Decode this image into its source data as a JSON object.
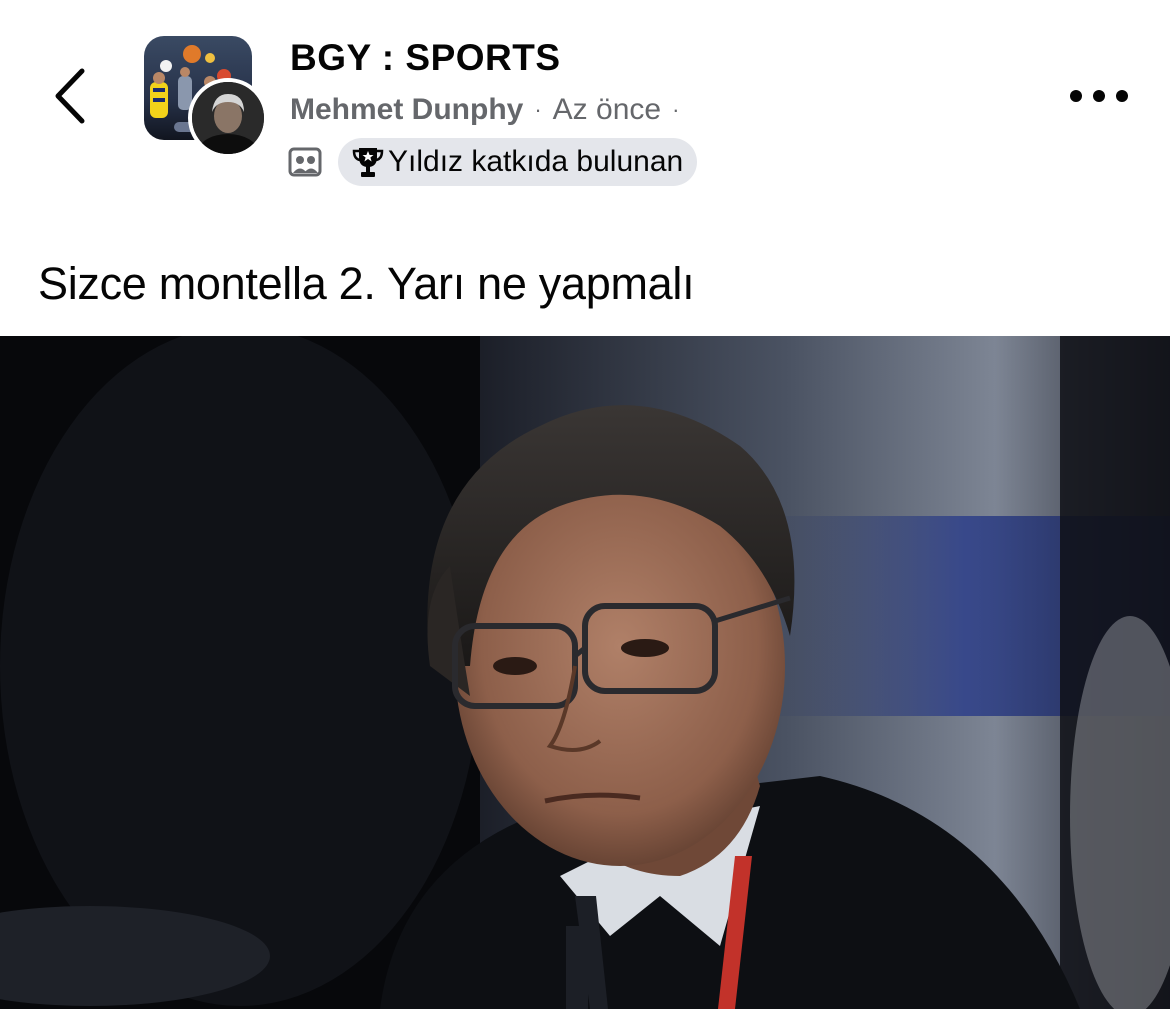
{
  "header": {
    "group_name": "BGY : SPORTS",
    "author_name": "Mehmet Dunphy",
    "separator": "·",
    "time": "Az önce",
    "badge_label": "Yıldız katkıda bulunan",
    "icons": {
      "back": "chevron-left-icon",
      "group_photo": "group-photo-icon",
      "badge": "trophy-icon",
      "more": "more-horizontal-icon"
    }
  },
  "post": {
    "text": "Sizce montella 2. Yarı ne yapmalı"
  },
  "colors": {
    "text_primary": "#050505",
    "text_secondary": "#65676b",
    "badge_bg": "#e4e6eb",
    "background": "#ffffff"
  }
}
